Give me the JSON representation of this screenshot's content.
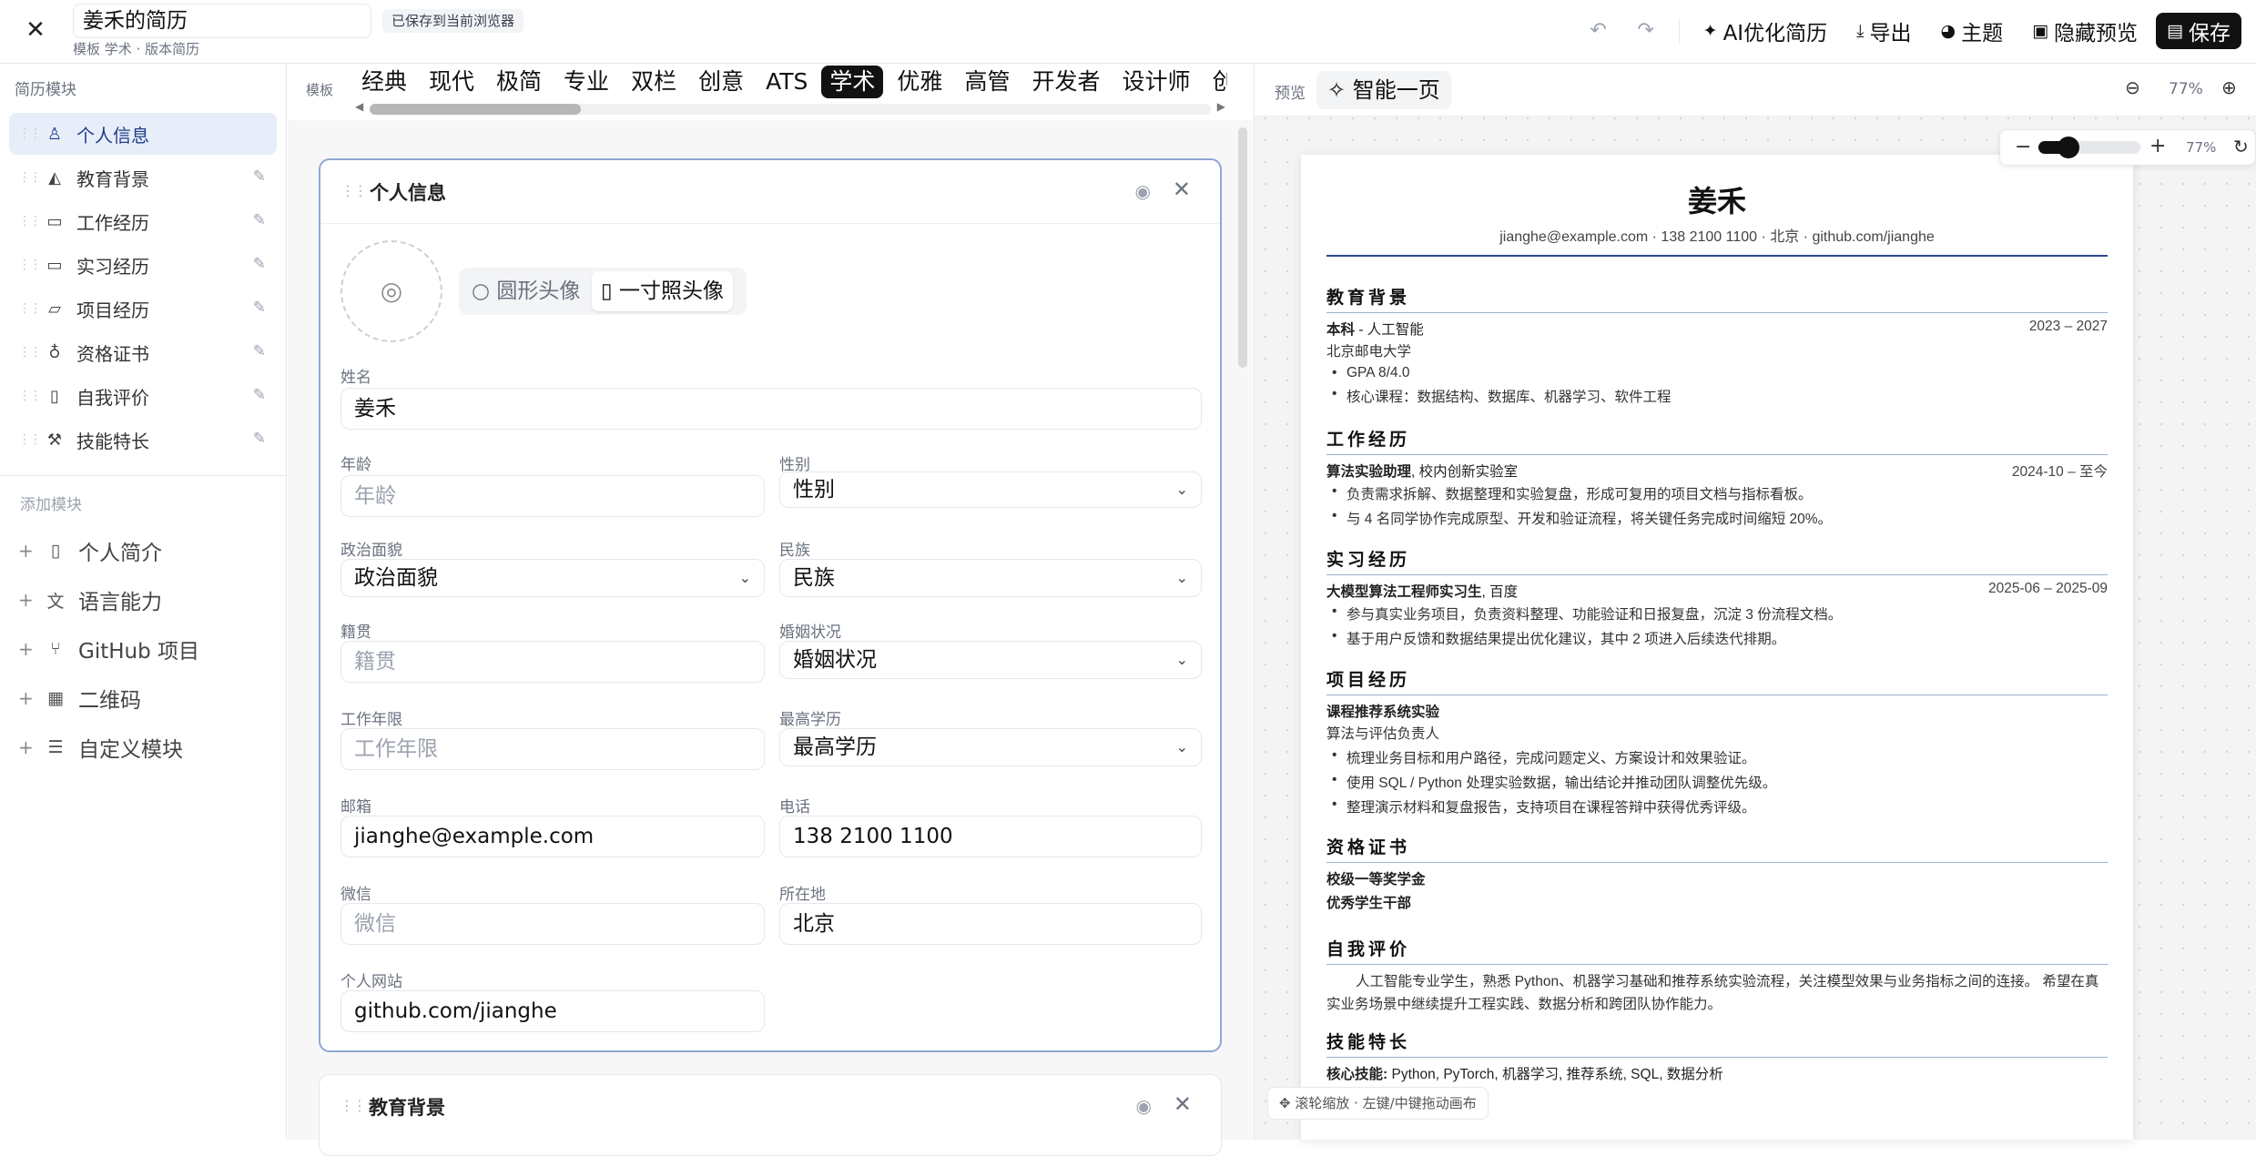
{
  "topbar": {
    "title_value": "姜禾的简历",
    "subtitle": "模板 学术 · 版本简历",
    "saved_badge": "已保存到当前浏览器",
    "ai_label": "AI优化简历",
    "export_label": "导出",
    "theme_label": "主题",
    "hide_preview_label": "隐藏预览",
    "save_label": "保存"
  },
  "sidebar": {
    "heading": "简历模块",
    "items": [
      {
        "label": "个人信息",
        "icon": "user-icon"
      },
      {
        "label": "教育背景",
        "icon": "graduation-cap-icon"
      },
      {
        "label": "工作经历",
        "icon": "briefcase-icon"
      },
      {
        "label": "实习经历",
        "icon": "briefcase-icon"
      },
      {
        "label": "项目经历",
        "icon": "folder-code-icon"
      },
      {
        "label": "资格证书",
        "icon": "award-icon"
      },
      {
        "label": "自我评价",
        "icon": "file-text-icon"
      },
      {
        "label": "技能特长",
        "icon": "wrench-icon"
      }
    ],
    "add_heading": "添加模块",
    "add_items": [
      {
        "label": "个人简介",
        "icon": "file-icon"
      },
      {
        "label": "语言能力",
        "icon": "languages-icon"
      },
      {
        "label": "GitHub 项目",
        "icon": "git-branch-icon"
      },
      {
        "label": "二维码",
        "icon": "qr-code-icon"
      },
      {
        "label": "自定义模块",
        "icon": "list-icon"
      }
    ]
  },
  "templates": {
    "label": "模板",
    "tabs": [
      "经典",
      "现代",
      "极简",
      "专业",
      "双栏",
      "创意",
      "ATS",
      "学术",
      "优雅",
      "高管",
      "开发者",
      "设计师",
      "创"
    ],
    "active": "学术"
  },
  "personal_card": {
    "title": "个人信息",
    "avatar_round": "圆形头像",
    "avatar_id": "一寸照头像",
    "name_label": "姓名",
    "name_value": "姜禾",
    "age_label": "年龄",
    "age_placeholder": "年龄",
    "gender_label": "性别",
    "gender_value": "性别",
    "political_label": "政治面貌",
    "political_value": "政治面貌",
    "ethnicity_label": "民族",
    "ethnicity_value": "民族",
    "hometown_label": "籍贯",
    "hometown_placeholder": "籍贯",
    "marital_label": "婚姻状况",
    "marital_value": "婚姻状况",
    "years_label": "工作年限",
    "years_placeholder": "工作年限",
    "degree_label": "最高学历",
    "degree_value": "最高学历",
    "email_label": "邮箱",
    "email_value": "jianghe@example.com",
    "phone_label": "电话",
    "phone_value": "138 2100 1100",
    "wechat_label": "微信",
    "wechat_placeholder": "微信",
    "location_label": "所在地",
    "location_value": "北京",
    "website_label": "个人网站",
    "website_value": "github.com/jianghe"
  },
  "education_card": {
    "title": "教育背景"
  },
  "preview": {
    "label": "预览",
    "smart_label": "智能一页",
    "zoom_text": "77%",
    "zoom_level": 0.77,
    "hint": "滚轮缩放 · 左键/中键拖动画布"
  },
  "resume": {
    "name": "姜禾",
    "contact": "jianghe@example.com · 138 2100 1100 · 北京 · github.com/jianghe",
    "education": {
      "title": "教育背景",
      "degree": "本科",
      "major": " - 人工智能",
      "dates": "2023 – 2027",
      "school": "北京邮电大学",
      "b1": "GPA 8/4.0",
      "b2": "核心课程：数据结构、数据库、机器学习、软件工程"
    },
    "work": {
      "title": "工作经历",
      "role": "算法实验助理",
      "org": ", 校内创新实验室",
      "dates": "2024-10 – 至今",
      "b1": "负责需求拆解、数据整理和实验复盘，形成可复用的项目文档与指标看板。",
      "b2": "与 4 名同学协作完成原型、开发和验证流程，将关键任务完成时间缩短 20%。"
    },
    "intern": {
      "title": "实习经历",
      "role": "大模型算法工程师实习生",
      "org": ", 百度",
      "dates": "2025-06 – 2025-09",
      "b1": "参与真实业务项目，负责资料整理、功能验证和日报复盘，沉淀 3 份流程文档。",
      "b2": "基于用户反馈和数据结果提出优化建议，其中 2 项进入后续迭代排期。"
    },
    "project": {
      "title": "项目经历",
      "name": "课程推荐系统实验",
      "role": "算法与评估负责人",
      "b1": "梳理业务目标和用户路径，完成问题定义、方案设计和效果验证。",
      "b2": "使用 SQL / Python 处理实验数据，输出结论并推动团队调整优先级。",
      "b3": "整理演示材料和复盘报告，支持项目在课程答辩中获得优秀评级。"
    },
    "certs": {
      "title": "资格证书",
      "c1": "校级一等奖学金",
      "c2": "优秀学生干部"
    },
    "self": {
      "title": "自我评价",
      "text": "人工智能专业学生，熟悉 Python、机器学习基础和推荐系统实验流程，关注模型效果与业务指标之间的连接。 希望在真实业务场景中继续提升工程实践、数据分析和跨团队协作能力。"
    },
    "skills": {
      "title": "技能特长",
      "label": "核心技能:",
      "text": " Python, PyTorch, 机器学习, 推荐系统, SQL, 数据分析"
    }
  }
}
